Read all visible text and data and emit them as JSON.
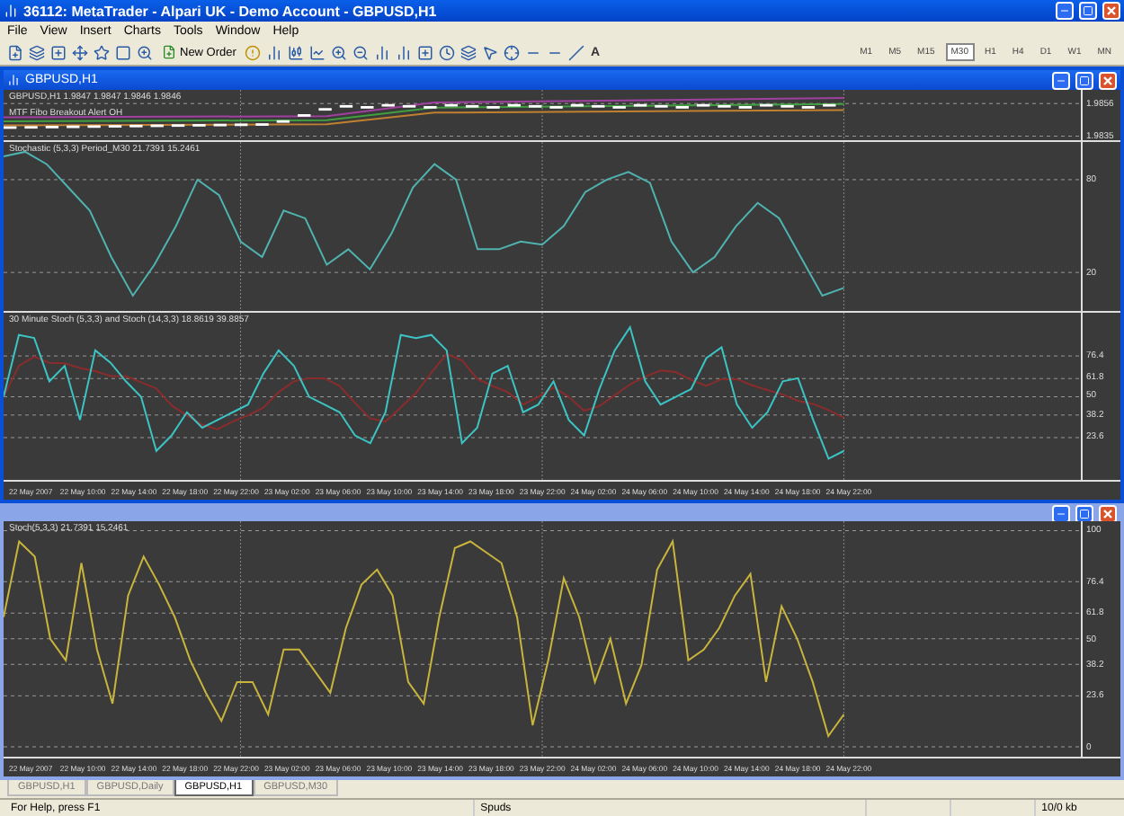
{
  "window": {
    "title": "36112: MetaTrader - Alpari UK - Demo Account - GBPUSD,H1"
  },
  "menu": [
    "File",
    "View",
    "Insert",
    "Charts",
    "Tools",
    "Window",
    "Help"
  ],
  "toolbar": {
    "new_order": "New Order",
    "text_tool": "A",
    "timeframes": [
      {
        "label": "M1",
        "selected": false
      },
      {
        "label": "M5",
        "selected": false
      },
      {
        "label": "M15",
        "selected": false
      },
      {
        "label": "M30",
        "selected": true
      },
      {
        "label": "H1",
        "selected": false
      },
      {
        "label": "H4",
        "selected": false
      },
      {
        "label": "D1",
        "selected": false
      },
      {
        "label": "W1",
        "selected": false
      },
      {
        "label": "MN",
        "selected": false
      }
    ]
  },
  "chart_windows": [
    {
      "title": "GBPUSD,H1",
      "active": true,
      "panels": [
        {
          "kind": "price",
          "legends": [
            "GBPUSD,H1  1.9847 1.9847 1.9846 1.9846",
            "MTF Fibo Breakout Alert OH"
          ],
          "ticks": [
            "1.9856",
            "1.9835"
          ]
        },
        {
          "kind": "oscillator",
          "legends": [
            "Stochastic (5,3,3) Period_M30 21.7391 15.2461"
          ],
          "ticks": [
            "80",
            "20"
          ],
          "lines": [
            {
              "kind": "main",
              "color": "#4fb3b0"
            }
          ]
        },
        {
          "kind": "oscillator",
          "legends": [
            "30 Minute Stoch (5,3,3) and Stoch (14,3,3) 18.8619 39.8857"
          ],
          "ticks": [
            "76.4",
            "61.8",
            "50",
            "38.2",
            "23.6"
          ],
          "lines": [
            {
              "kind": "signal",
              "color": "#8a2c2c"
            },
            {
              "kind": "fast",
              "color": "#3cc4c4"
            }
          ]
        }
      ],
      "times": [
        "22 May 2007",
        "22 May 10:00",
        "22 May 14:00",
        "22 May 18:00",
        "22 May 22:00",
        "23 May 02:00",
        "23 May 06:00",
        "23 May 10:00",
        "23 May 14:00",
        "23 May 18:00",
        "23 May 22:00",
        "24 May 02:00",
        "24 May 06:00",
        "24 May 10:00",
        "24 May 14:00",
        "24 May 18:00",
        "24 May 22:00"
      ]
    },
    {
      "active": false,
      "panels": [
        {
          "kind": "oscillator",
          "legends": [
            "Stoch(5,3,3) 21.7391 15.2461"
          ],
          "ticks": [
            "100",
            "76.4",
            "61.8",
            "50",
            "38.2",
            "23.6",
            "0"
          ],
          "lines": [
            {
              "kind": "yellow",
              "color": "#c9b43c"
            }
          ]
        }
      ],
      "times": [
        "22 May 2007",
        "22 May 10:00",
        "22 May 14:00",
        "22 May 18:00",
        "22 May 22:00",
        "23 May 02:00",
        "23 May 06:00",
        "23 May 10:00",
        "23 May 14:00",
        "23 May 18:00",
        "23 May 22:00",
        "24 May 02:00",
        "24 May 06:00",
        "24 May 10:00",
        "24 May 14:00",
        "24 May 18:00",
        "24 May 22:00"
      ]
    }
  ],
  "tabs": [
    {
      "label": "GBPUSD,H1",
      "selected": false
    },
    {
      "label": "GBPUSD,Daily",
      "selected": false
    },
    {
      "label": "GBPUSD,H1",
      "selected": true
    },
    {
      "label": "GBPUSD,M30",
      "selected": false
    }
  ],
  "status_bar": {
    "help": "For Help, press F1",
    "profile": "Spuds",
    "traffic": "10/0 kb"
  }
}
